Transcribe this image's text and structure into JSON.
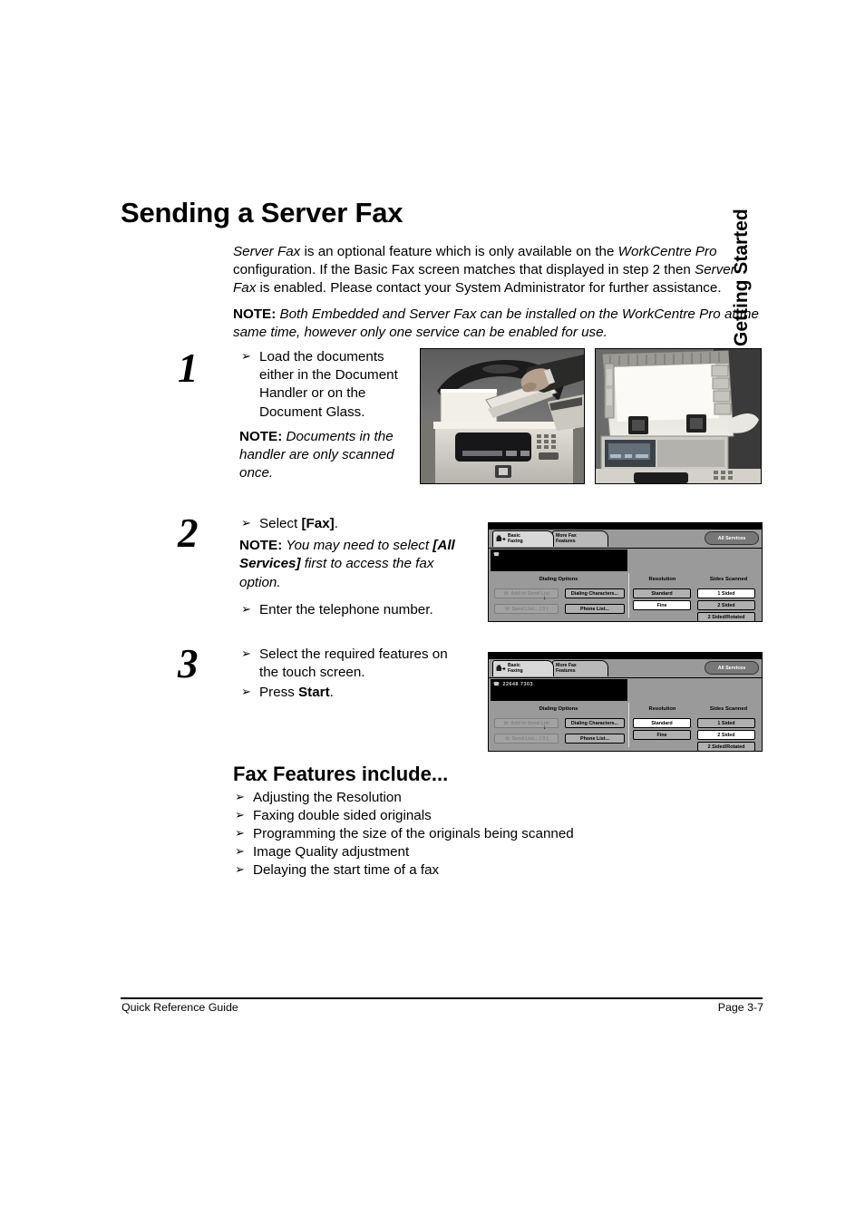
{
  "page": {
    "title": "Sending a Server Fax",
    "chapter_tab": "Getting Started"
  },
  "intro": {
    "paragraph_1_part1": "Server Fax",
    "paragraph_1_part2": " is an optional feature which is only available on the ",
    "paragraph_1_part3": "WorkCentre Pro",
    "paragraph_1_part4": " configuration. If the Basic Fax screen matches that displayed in step 2 then ",
    "paragraph_1_part5": "Server Fax",
    "paragraph_1_part6": " is enabled. Please contact your System Administrator for further assistance.",
    "note_label": "NOTE:",
    "note_text": " Both Embedded and Server Fax can be installed on the WorkCentre Pro at the same time, however only one service can be enabled for use."
  },
  "steps": [
    {
      "number": "1",
      "bullets": [
        "Load the documents either in the Document Handler or on the Document Glass."
      ],
      "note_label": "NOTE:",
      "note_text": " Documents in the handler are only scanned once.",
      "photos": [
        {
          "name": "document-handler-photo",
          "alt": "Hand loading documents into the Document Handler"
        },
        {
          "name": "document-glass-photo",
          "alt": "Document Glass with cover raised"
        }
      ]
    },
    {
      "number": "2",
      "bullet_1_pre": "Select ",
      "bullet_1_bold": "[Fax]",
      "bullet_1_post": ".",
      "note_label": "NOTE:",
      "note_pre": " You may need to select ",
      "note_bold": "[All Services]",
      "note_post": " first to access the fax option.",
      "bullet_2": "Enter the telephone number."
    },
    {
      "number": "3",
      "bullet_1": "Select the required features on the touch screen.",
      "bullet_2_pre": "Press ",
      "bullet_2_bold": "Start",
      "bullet_2_post": "."
    }
  ],
  "fax_ui_step2": {
    "tabs": [
      {
        "label_line1": "Basic",
        "label_line2": "Faxing",
        "active": true
      },
      {
        "label_line1": "More Fax",
        "label_line2": "Features",
        "active": false
      }
    ],
    "all_services_button": "All Services",
    "phone_number": "",
    "dialing_options_header": "Dialing Options",
    "add_to_send_list": "Add to Send List",
    "dialing_characters": "Dialing Characters...",
    "send_list": "Send List... ( 0 )",
    "phone_list": "Phone List...",
    "resolution_header": "Resolution",
    "resolution_options": [
      {
        "label": "Standard",
        "selected": false
      },
      {
        "label": "Fine",
        "selected": true
      }
    ],
    "sides_header": "Sides Scanned",
    "sides_options": [
      {
        "label": "1 Sided",
        "selected": true
      },
      {
        "label": "2 Sided",
        "selected": false
      },
      {
        "label": "2 Sided/Rotated",
        "selected": false
      }
    ]
  },
  "fax_ui_step3": {
    "tabs": [
      {
        "label_line1": "Basic",
        "label_line2": "Faxing",
        "active": true
      },
      {
        "label_line1": "More Fax",
        "label_line2": "Features",
        "active": false
      }
    ],
    "all_services_button": "All Services",
    "phone_number": "22648 7303",
    "dialing_options_header": "Dialing Options",
    "add_to_send_list": "Add to Send List",
    "dialing_characters": "Dialing Characters...",
    "send_list": "Send List... ( 0 )",
    "phone_list": "Phone List...",
    "resolution_header": "Resolution",
    "resolution_options": [
      {
        "label": "Standard",
        "selected": true
      },
      {
        "label": "Fine",
        "selected": false
      }
    ],
    "sides_header": "Sides Scanned",
    "sides_options": [
      {
        "label": "1 Sided",
        "selected": false
      },
      {
        "label": "2 Sided",
        "selected": true
      },
      {
        "label": "2 Sided/Rotated",
        "selected": false
      }
    ]
  },
  "features_section": {
    "heading": "Fax Features include...",
    "items": [
      "Adjusting the Resolution",
      "Faxing double sided originals",
      "Programming the size of the originals being scanned",
      "Image Quality adjustment",
      "Delaying the start time of a fax"
    ]
  },
  "footer": {
    "left": "Quick Reference Guide",
    "right": "Page 3-7"
  },
  "icons": {
    "bullet_arrow": "➢",
    "phone_icon": "☎",
    "down_arrow": "↓"
  }
}
